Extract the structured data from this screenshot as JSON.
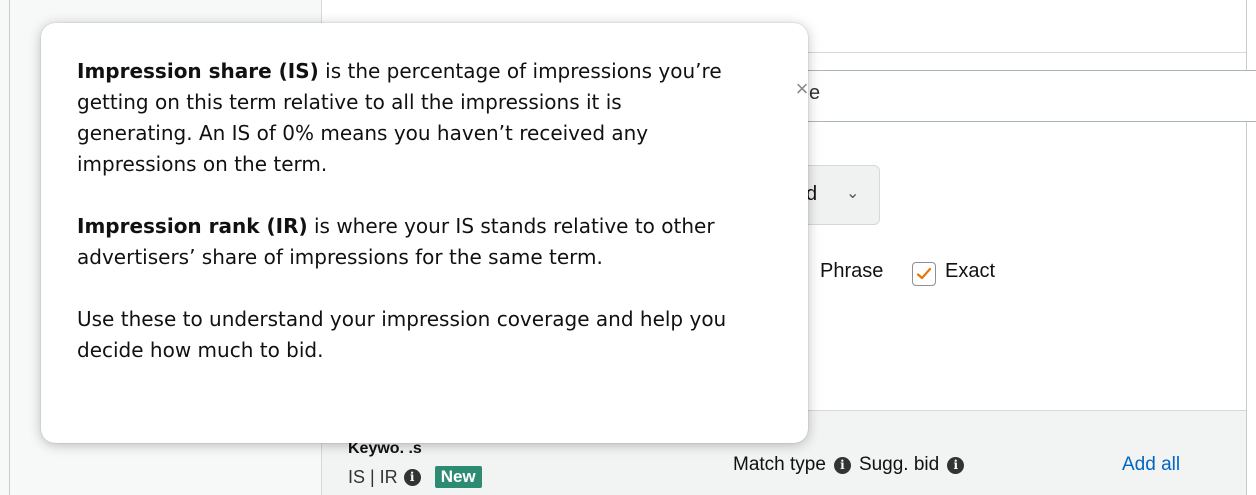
{
  "background": {
    "search_text": "e",
    "dropdown_label": "d",
    "match_options": {
      "phrase": "Phrase",
      "exact": "Exact",
      "exact_checked": true
    }
  },
  "table_header": {
    "keywords": "Keywo. .s",
    "is_ir": "IS | IR",
    "new_badge": "New",
    "match_type": "Match type",
    "sugg_bid": "Sugg. bid",
    "add_all": "Add all"
  },
  "popover": {
    "p1_bold": "Impression share (IS)",
    "p1_text": " is the percentage of impressions you’re getting on this term relative to all the impressions it is generating. An IS of 0% means you haven’t received any impressions on the term.",
    "p2_bold": "Impression rank (IR)",
    "p2_text": " is where your IS stands relative to other advertisers’ share of impressions for the same term.",
    "p3_text": "Use these to understand your impression coverage and help you decide how much to bid.",
    "close_glyph": "×"
  },
  "colors": {
    "accent_link": "#0066c0",
    "badge_green": "#2e8b73",
    "checkbox_check": "#e77600"
  }
}
